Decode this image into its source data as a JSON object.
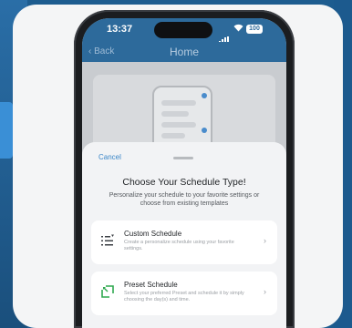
{
  "status_bar": {
    "time": "13:37",
    "battery": "100"
  },
  "nav": {
    "back_label": "Back",
    "title": "Home"
  },
  "sheet": {
    "cancel_label": "Cancel",
    "title": "Choose Your Schedule Type!",
    "subtitle": "Personalize your schedule to your favorite settings or choose from existing templates",
    "options": [
      {
        "title": "Custom Schedule",
        "description": "Create a personalize schedule using your favorite settings.",
        "icon": "list-filter-icon"
      },
      {
        "title": "Preset Schedule",
        "description": "Select your preferred Preset and schedule it by simply choosing the day(s) and time.",
        "icon": "preset-icon"
      }
    ]
  },
  "colors": {
    "background": "#1d5c8f",
    "accent": "#3a86c8",
    "nav_bar": "#2d6a9b",
    "preset_icon_green": "#2fa84f"
  }
}
